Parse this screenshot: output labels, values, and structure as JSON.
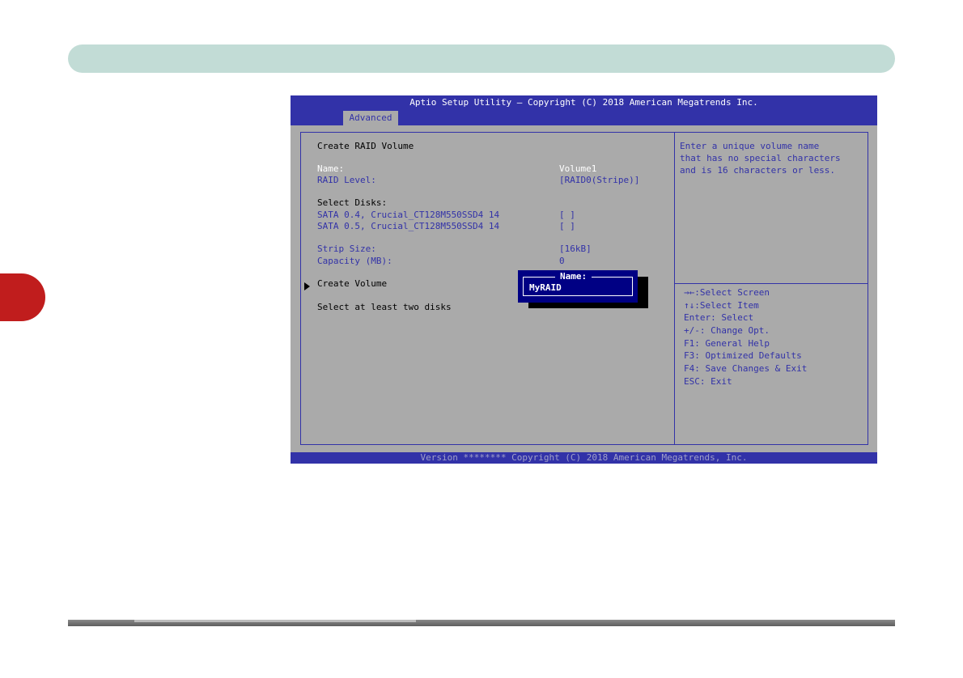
{
  "bios": {
    "title": "Aptio Setup Utility – Copyright (C) 2018 American Megatrends Inc.",
    "tab": "Advanced",
    "footer": "Version ******** Copyright (C) 2018 American Megatrends, Inc.",
    "section_title": "Create RAID Volume",
    "name_label": "Name:",
    "name_value": "Volume1",
    "raid_level_label": "RAID Level:",
    "raid_level_value": "[RAID0(Stripe)]",
    "select_disks_label": "Select Disks:",
    "disks": [
      {
        "label": "SATA 0.4, Crucial_CT128M550SSD4 14",
        "value": "[ ]"
      },
      {
        "label": "SATA 0.5, Crucial_CT128M550SSD4 14",
        "value": "[ ]"
      }
    ],
    "strip_size_label": "Strip Size:",
    "strip_size_value": "[16kB]",
    "capacity_label": "Capacity (MB):",
    "capacity_value": "0",
    "create_volume_label": "Create Volume",
    "hint": "Select at least two disks",
    "help_lines": [
      "Enter a unique volume name",
      "that has no special characters",
      "and is 16 characters or less."
    ],
    "key_help": [
      "→←:Select Screen",
      "↑↓:Select Item",
      "Enter: Select",
      "+/-: Change Opt.",
      "F1: General Help",
      "F3: Optimized Defaults",
      "F4: Save Changes & Exit",
      "ESC: Exit"
    ],
    "popup": {
      "title": "Name:",
      "value": "MyRAID"
    }
  },
  "colors": {
    "header_bar": "#c2dcd6",
    "side_tab": "#c01d1d",
    "bios_blue": "#3232a8",
    "bios_gray": "#aaaaaa",
    "popup_bg": "#000084"
  }
}
